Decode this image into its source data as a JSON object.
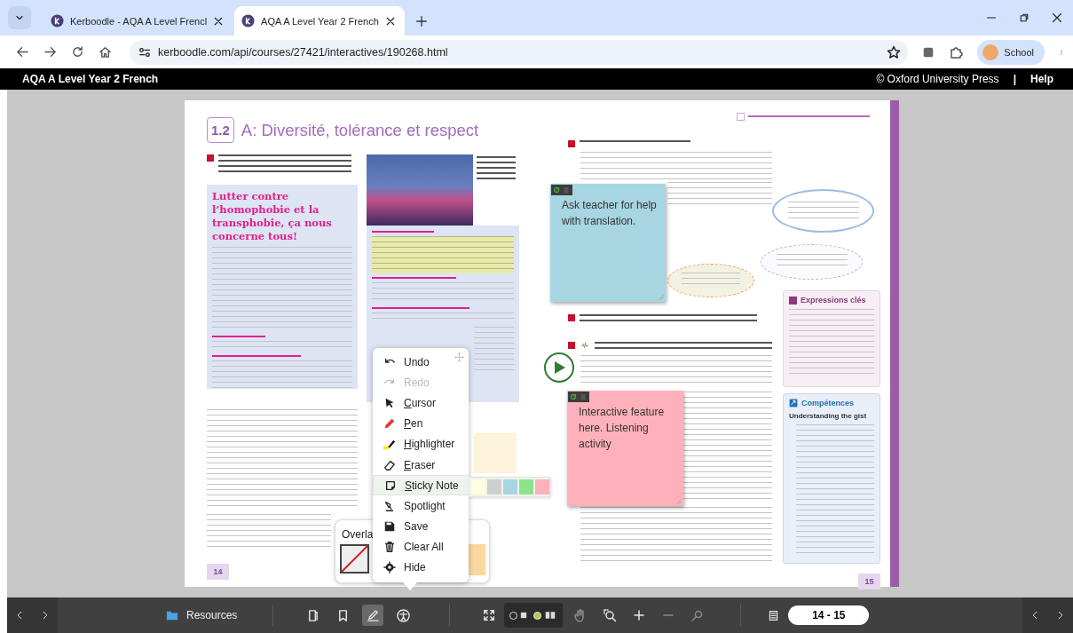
{
  "browser": {
    "tabs": [
      {
        "title": "Kerboodle - AQA A Level Frencl",
        "selected": false
      },
      {
        "title": "AQA A Level Year 2 French",
        "selected": true
      }
    ],
    "url": "kerboodle.com/api/courses/27421/interactives/190268.html",
    "profile": "School"
  },
  "header": {
    "title": "AQA A Level Year 2 French",
    "copyright": "© Oxford University Press",
    "separator": "|",
    "help": "Help"
  },
  "left_page": {
    "section_number": "1.2",
    "title": "A: Diversité, tolérance et respect",
    "article_title": "Lutter contre l’homophobie et la transphobie, ça nous concerne tous!",
    "page_number": "14"
  },
  "right_page": {
    "speech_bubbles": [
      {
        "kind": "round"
      },
      {
        "kind": "cloud"
      },
      {
        "kind": "dashed"
      }
    ],
    "expressions_title": "Expressions clés",
    "skills_title": "Compétences",
    "skills_subtitle": "Understanding the gist",
    "page_number": "15"
  },
  "sticky_notes": [
    {
      "text": "Ask teacher for help with translation.",
      "color": "#a8d5e2"
    },
    {
      "text": "Interactive feature here. Listening activity",
      "color": "#ffb1bb"
    }
  ],
  "tool_menu": {
    "items": [
      {
        "kind": "undo",
        "label": "Undo",
        "underline_first": false,
        "disabled": false,
        "selected": false
      },
      {
        "kind": "redo",
        "label": "Redo",
        "underline_first": false,
        "disabled": true,
        "selected": false
      },
      {
        "kind": "cursor",
        "label": "Cursor",
        "underline_first": true,
        "disabled": false,
        "selected": false
      },
      {
        "kind": "pen",
        "label": "Pen",
        "underline_first": true,
        "disabled": false,
        "selected": false
      },
      {
        "kind": "highlighter",
        "label": "Highlighter",
        "underline_first": true,
        "disabled": false,
        "selected": false
      },
      {
        "kind": "eraser",
        "label": "Eraser",
        "underline_first": true,
        "disabled": false,
        "selected": false
      },
      {
        "kind": "sticky",
        "label": "Sticky Note",
        "underline_first": true,
        "disabled": false,
        "selected": true
      },
      {
        "kind": "spotlight",
        "label": "Spotlight",
        "underline_first": false,
        "disabled": false,
        "selected": false
      },
      {
        "kind": "save",
        "label": "Save",
        "underline_first": false,
        "disabled": false,
        "selected": false
      },
      {
        "kind": "clear",
        "label": "Clear All",
        "underline_first": false,
        "disabled": false,
        "selected": false
      },
      {
        "kind": "hide",
        "label": "Hide",
        "underline_first": false,
        "disabled": false,
        "selected": false
      }
    ],
    "sticky_colors": [
      {
        "color": "#fffde0"
      },
      {
        "color": "#cfcfcf"
      },
      {
        "color": "#a8d5e2"
      },
      {
        "color": "#8de38a"
      },
      {
        "color": "#ffb1bb"
      }
    ]
  },
  "overlay_panel": {
    "title": "Overla"
  },
  "toolbar": {
    "resources": "Resources",
    "tools": [
      {
        "kind": "pages",
        "selected": false
      },
      {
        "kind": "bookmark",
        "selected": false
      },
      {
        "kind": "pen",
        "selected": true
      },
      {
        "kind": "accessibility",
        "selected": false
      }
    ],
    "view_modes": [
      {
        "kind": "single",
        "selected": false
      },
      {
        "kind": "double",
        "selected": true
      }
    ],
    "zoom": [
      {
        "kind": "pan",
        "disabled": true
      },
      {
        "kind": "zoom_area",
        "disabled": false
      },
      {
        "kind": "zoom_in",
        "disabled": false
      },
      {
        "kind": "zoom_out",
        "disabled": true
      },
      {
        "kind": "reset",
        "disabled": true
      }
    ],
    "page_range": "14 - 15"
  }
}
